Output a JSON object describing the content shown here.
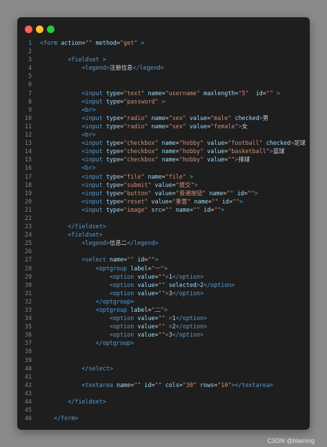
{
  "window": {
    "controls": [
      "close",
      "minimize",
      "maximize"
    ]
  },
  "colors": {
    "background": "#1e1e1e",
    "tag": "#569cd6",
    "attribute": "#9cdcfe",
    "string": "#ce9178",
    "text": "#d4d4d4",
    "line_number": "#858585"
  },
  "code_lines": [
    {
      "n": "1",
      "tokens": [
        [
          "tag",
          "<form "
        ],
        [
          "attr",
          "action"
        ],
        [
          "text",
          "="
        ],
        [
          "val",
          "\"\""
        ],
        [
          "text",
          " "
        ],
        [
          "attr",
          "method"
        ],
        [
          "text",
          "="
        ],
        [
          "val",
          "\"get\""
        ],
        [
          "tag",
          " >"
        ]
      ]
    },
    {
      "n": "2",
      "tokens": []
    },
    {
      "n": "3",
      "tokens": [
        [
          "tag",
          "        <fieldset "
        ],
        [
          "tag",
          ">"
        ]
      ]
    },
    {
      "n": "4",
      "tokens": [
        [
          "tag",
          "            <legend>"
        ],
        [
          "text",
          "注册信息"
        ],
        [
          "tag",
          "</legend>"
        ]
      ]
    },
    {
      "n": "5",
      "tokens": []
    },
    {
      "n": "6",
      "tokens": []
    },
    {
      "n": "7",
      "tokens": [
        [
          "tag",
          "            <input "
        ],
        [
          "attr",
          "type"
        ],
        [
          "text",
          "="
        ],
        [
          "val",
          "\"text\""
        ],
        [
          "text",
          " "
        ],
        [
          "attr",
          "name"
        ],
        [
          "text",
          "="
        ],
        [
          "val",
          "\"username\""
        ],
        [
          "text",
          " "
        ],
        [
          "attr",
          "maxlength"
        ],
        [
          "text",
          "="
        ],
        [
          "val",
          "\"5\""
        ],
        [
          "text",
          "  "
        ],
        [
          "attr",
          "id"
        ],
        [
          "text",
          "="
        ],
        [
          "val",
          "\"\""
        ],
        [
          "tag",
          " >"
        ]
      ]
    },
    {
      "n": "8",
      "tokens": [
        [
          "tag",
          "            <input "
        ],
        [
          "attr",
          "type"
        ],
        [
          "text",
          "="
        ],
        [
          "val",
          "\"password\""
        ],
        [
          "tag",
          " >"
        ]
      ]
    },
    {
      "n": "9",
      "tokens": [
        [
          "tag",
          "            <br>"
        ]
      ]
    },
    {
      "n": "10",
      "tokens": [
        [
          "tag",
          "            <input "
        ],
        [
          "attr",
          "type"
        ],
        [
          "text",
          "="
        ],
        [
          "val",
          "\"radio\""
        ],
        [
          "text",
          " "
        ],
        [
          "attr",
          "name"
        ],
        [
          "text",
          "="
        ],
        [
          "val",
          "\"sex\""
        ],
        [
          "text",
          " "
        ],
        [
          "attr",
          "value"
        ],
        [
          "text",
          "="
        ],
        [
          "val",
          "\"male\""
        ],
        [
          "text",
          " "
        ],
        [
          "attr",
          "checked"
        ],
        [
          "tag",
          ">"
        ],
        [
          "text",
          "男"
        ]
      ]
    },
    {
      "n": "11",
      "tokens": [
        [
          "tag",
          "            <input "
        ],
        [
          "attr",
          "type"
        ],
        [
          "text",
          "="
        ],
        [
          "val",
          "\"radio\""
        ],
        [
          "text",
          " "
        ],
        [
          "attr",
          "name"
        ],
        [
          "text",
          "="
        ],
        [
          "val",
          "\"sex\""
        ],
        [
          "text",
          " "
        ],
        [
          "attr",
          "value"
        ],
        [
          "text",
          "="
        ],
        [
          "val",
          "\"female\""
        ],
        [
          "tag",
          ">"
        ],
        [
          "text",
          "女"
        ]
      ]
    },
    {
      "n": "12",
      "tokens": [
        [
          "tag",
          "            <br>"
        ]
      ]
    },
    {
      "n": "13",
      "tokens": [
        [
          "tag",
          "            <input "
        ],
        [
          "attr",
          "type"
        ],
        [
          "text",
          "="
        ],
        [
          "val",
          "\"checkbox\""
        ],
        [
          "text",
          " "
        ],
        [
          "attr",
          "name"
        ],
        [
          "text",
          "="
        ],
        [
          "val",
          "\"hobby\""
        ],
        [
          "text",
          " "
        ],
        [
          "attr",
          "value"
        ],
        [
          "text",
          "="
        ],
        [
          "val",
          "\"football\""
        ],
        [
          "text",
          " "
        ],
        [
          "attr",
          "checked"
        ],
        [
          "tag",
          ">"
        ],
        [
          "text",
          "足球"
        ]
      ]
    },
    {
      "n": "14",
      "tokens": [
        [
          "tag",
          "            <input "
        ],
        [
          "attr",
          "type"
        ],
        [
          "text",
          "="
        ],
        [
          "val",
          "\"checkbox\""
        ],
        [
          "text",
          " "
        ],
        [
          "attr",
          "name"
        ],
        [
          "text",
          "="
        ],
        [
          "val",
          "\"hobby\""
        ],
        [
          "text",
          " "
        ],
        [
          "attr",
          "value"
        ],
        [
          "text",
          "="
        ],
        [
          "val",
          "\"basketball\""
        ],
        [
          "tag",
          ">"
        ],
        [
          "text",
          "蓝球"
        ]
      ]
    },
    {
      "n": "15",
      "tokens": [
        [
          "tag",
          "            <input "
        ],
        [
          "attr",
          "type"
        ],
        [
          "text",
          "="
        ],
        [
          "val",
          "\"checkbox\""
        ],
        [
          "text",
          " "
        ],
        [
          "attr",
          "name"
        ],
        [
          "text",
          "="
        ],
        [
          "val",
          "\"hobby\""
        ],
        [
          "text",
          " "
        ],
        [
          "attr",
          "value"
        ],
        [
          "text",
          "="
        ],
        [
          "val",
          "\"\""
        ],
        [
          "tag",
          ">"
        ],
        [
          "text",
          "排球"
        ]
      ]
    },
    {
      "n": "16",
      "tokens": [
        [
          "tag",
          "            <br>"
        ]
      ]
    },
    {
      "n": "17",
      "tokens": [
        [
          "tag",
          "            <input "
        ],
        [
          "attr",
          "type"
        ],
        [
          "text",
          "="
        ],
        [
          "val",
          "\"file\""
        ],
        [
          "text",
          " "
        ],
        [
          "attr",
          "name"
        ],
        [
          "text",
          "="
        ],
        [
          "val",
          "\"file\""
        ],
        [
          "tag",
          " >"
        ]
      ]
    },
    {
      "n": "18",
      "tokens": [
        [
          "tag",
          "            <input "
        ],
        [
          "attr",
          "type"
        ],
        [
          "text",
          "="
        ],
        [
          "val",
          "\"submit\""
        ],
        [
          "text",
          " "
        ],
        [
          "attr",
          "value"
        ],
        [
          "text",
          "="
        ],
        [
          "val",
          "\"提交\""
        ],
        [
          "tag",
          ">"
        ]
      ]
    },
    {
      "n": "19",
      "tokens": [
        [
          "tag",
          "            <input "
        ],
        [
          "attr",
          "type"
        ],
        [
          "text",
          "="
        ],
        [
          "val",
          "\"button\""
        ],
        [
          "text",
          " "
        ],
        [
          "attr",
          "value"
        ],
        [
          "text",
          "="
        ],
        [
          "val",
          "\"普通按钮\""
        ],
        [
          "text",
          " "
        ],
        [
          "attr",
          "name"
        ],
        [
          "text",
          "="
        ],
        [
          "val",
          "\"\""
        ],
        [
          "text",
          " "
        ],
        [
          "attr",
          "id"
        ],
        [
          "text",
          "="
        ],
        [
          "val",
          "\"\""
        ],
        [
          "tag",
          ">"
        ]
      ]
    },
    {
      "n": "20",
      "tokens": [
        [
          "tag",
          "            <input "
        ],
        [
          "attr",
          "type"
        ],
        [
          "text",
          "="
        ],
        [
          "val",
          "\"reset\""
        ],
        [
          "text",
          " "
        ],
        [
          "attr",
          "value"
        ],
        [
          "text",
          "="
        ],
        [
          "val",
          "\"重置\""
        ],
        [
          "text",
          " "
        ],
        [
          "attr",
          "name"
        ],
        [
          "text",
          "="
        ],
        [
          "val",
          "\"\""
        ],
        [
          "text",
          " "
        ],
        [
          "attr",
          "id"
        ],
        [
          "text",
          "="
        ],
        [
          "val",
          "\"\""
        ],
        [
          "tag",
          ">"
        ]
      ]
    },
    {
      "n": "21",
      "tokens": [
        [
          "tag",
          "            <input "
        ],
        [
          "attr",
          "type"
        ],
        [
          "text",
          "="
        ],
        [
          "val",
          "\"image\""
        ],
        [
          "text",
          " "
        ],
        [
          "attr",
          "src"
        ],
        [
          "text",
          "="
        ],
        [
          "val",
          "\"\""
        ],
        [
          "text",
          " "
        ],
        [
          "attr",
          "name"
        ],
        [
          "text",
          "="
        ],
        [
          "val",
          "\"\""
        ],
        [
          "text",
          " "
        ],
        [
          "attr",
          "id"
        ],
        [
          "text",
          "="
        ],
        [
          "val",
          "\"\""
        ],
        [
          "tag",
          ">"
        ]
      ]
    },
    {
      "n": "22",
      "tokens": []
    },
    {
      "n": "23",
      "tokens": [
        [
          "tag",
          "        </fieldset>"
        ]
      ]
    },
    {
      "n": "24",
      "tokens": [
        [
          "tag",
          "        <fieldset>"
        ]
      ]
    },
    {
      "n": "25",
      "tokens": [
        [
          "tag",
          "            <legend>"
        ],
        [
          "text",
          "信息二"
        ],
        [
          "tag",
          "</legend>"
        ]
      ]
    },
    {
      "n": "26",
      "tokens": []
    },
    {
      "n": "27",
      "tokens": [
        [
          "tag",
          "            <select "
        ],
        [
          "attr",
          "name"
        ],
        [
          "text",
          "="
        ],
        [
          "val",
          "\"\""
        ],
        [
          "text",
          " "
        ],
        [
          "attr",
          "id"
        ],
        [
          "text",
          "="
        ],
        [
          "val",
          "\"\""
        ],
        [
          "tag",
          ">"
        ]
      ]
    },
    {
      "n": "28",
      "tokens": [
        [
          "tag",
          "                <optgroup "
        ],
        [
          "attr",
          "label"
        ],
        [
          "text",
          "="
        ],
        [
          "val",
          "\"一\""
        ],
        [
          "tag",
          ">"
        ]
      ]
    },
    {
      "n": "29",
      "tokens": [
        [
          "tag",
          "                    <option "
        ],
        [
          "attr",
          "value"
        ],
        [
          "text",
          "="
        ],
        [
          "val",
          "\"\""
        ],
        [
          "tag",
          ">"
        ],
        [
          "text",
          "1"
        ],
        [
          "tag",
          "</option>"
        ]
      ]
    },
    {
      "n": "30",
      "tokens": [
        [
          "tag",
          "                    <option "
        ],
        [
          "attr",
          "value"
        ],
        [
          "text",
          "="
        ],
        [
          "val",
          "\"\""
        ],
        [
          "text",
          " "
        ],
        [
          "attr",
          "selected"
        ],
        [
          "tag",
          ">"
        ],
        [
          "text",
          "2"
        ],
        [
          "tag",
          "</option>"
        ]
      ]
    },
    {
      "n": "31",
      "tokens": [
        [
          "tag",
          "                    <option "
        ],
        [
          "attr",
          "value"
        ],
        [
          "text",
          "="
        ],
        [
          "val",
          "\"\""
        ],
        [
          "tag",
          ">"
        ],
        [
          "text",
          "3"
        ],
        [
          "tag",
          "</option>"
        ]
      ]
    },
    {
      "n": "32",
      "tokens": [
        [
          "tag",
          "                </optgroup>"
        ]
      ]
    },
    {
      "n": "33",
      "tokens": [
        [
          "tag",
          "                <optgroup "
        ],
        [
          "attr",
          "label"
        ],
        [
          "text",
          "="
        ],
        [
          "val",
          "\"二\""
        ],
        [
          "tag",
          ">"
        ]
      ]
    },
    {
      "n": "34",
      "tokens": [
        [
          "tag",
          "                    <option "
        ],
        [
          "attr",
          "value"
        ],
        [
          "text",
          "="
        ],
        [
          "val",
          "\"\""
        ],
        [
          "tag",
          " >"
        ],
        [
          "text",
          "1"
        ],
        [
          "tag",
          "</option>"
        ]
      ]
    },
    {
      "n": "35",
      "tokens": [
        [
          "tag",
          "                    <option "
        ],
        [
          "attr",
          "value"
        ],
        [
          "text",
          "="
        ],
        [
          "val",
          "\"\""
        ],
        [
          "tag",
          " >"
        ],
        [
          "text",
          "2"
        ],
        [
          "tag",
          "</option>"
        ]
      ]
    },
    {
      "n": "36",
      "tokens": [
        [
          "tag",
          "                    <option "
        ],
        [
          "attr",
          "value"
        ],
        [
          "text",
          "="
        ],
        [
          "val",
          "\"\""
        ],
        [
          "tag",
          ">"
        ],
        [
          "text",
          "3"
        ],
        [
          "tag",
          "</option>"
        ]
      ]
    },
    {
      "n": "37",
      "tokens": [
        [
          "tag",
          "                </optgroup>"
        ]
      ]
    },
    {
      "n": "38",
      "tokens": []
    },
    {
      "n": "39",
      "tokens": []
    },
    {
      "n": "40",
      "tokens": [
        [
          "tag",
          "            </select>"
        ]
      ]
    },
    {
      "n": "41",
      "tokens": []
    },
    {
      "n": "42",
      "tokens": [
        [
          "tag",
          "            <textarea "
        ],
        [
          "attr",
          "name"
        ],
        [
          "text",
          "="
        ],
        [
          "val",
          "\"\""
        ],
        [
          "text",
          " "
        ],
        [
          "attr",
          "id"
        ],
        [
          "text",
          "="
        ],
        [
          "val",
          "\"\""
        ],
        [
          "text",
          " "
        ],
        [
          "attr",
          "cols"
        ],
        [
          "text",
          "="
        ],
        [
          "val",
          "\"30\""
        ],
        [
          "text",
          " "
        ],
        [
          "attr",
          "rows"
        ],
        [
          "text",
          "="
        ],
        [
          "val",
          "\"10\""
        ],
        [
          "tag",
          "></textarea>"
        ]
      ]
    },
    {
      "n": "43",
      "tokens": []
    },
    {
      "n": "44",
      "tokens": [
        [
          "tag",
          "        </fieldset>"
        ]
      ]
    },
    {
      "n": "45",
      "tokens": []
    },
    {
      "n": "46",
      "tokens": [
        [
          "tag",
          "    </form>"
        ]
      ]
    }
  ],
  "watermark": "CSDN @blaming"
}
